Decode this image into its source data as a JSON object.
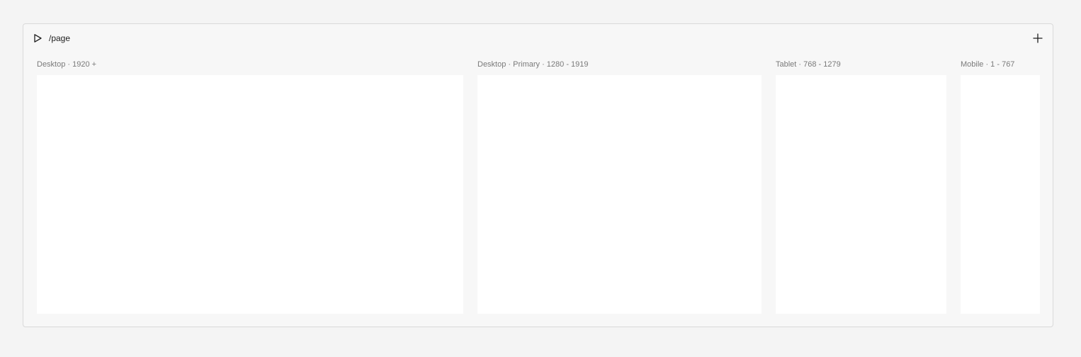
{
  "header": {
    "route": "/page",
    "play_icon": "play-icon",
    "add_icon": "plus-icon"
  },
  "breakpoints": [
    {
      "label": "Desktop · 1920 +"
    },
    {
      "label": "Desktop · Primary · 1280 - 1919"
    },
    {
      "label": "Tablet · 768 - 1279"
    },
    {
      "label": "Mobile · 1 - 767"
    }
  ]
}
